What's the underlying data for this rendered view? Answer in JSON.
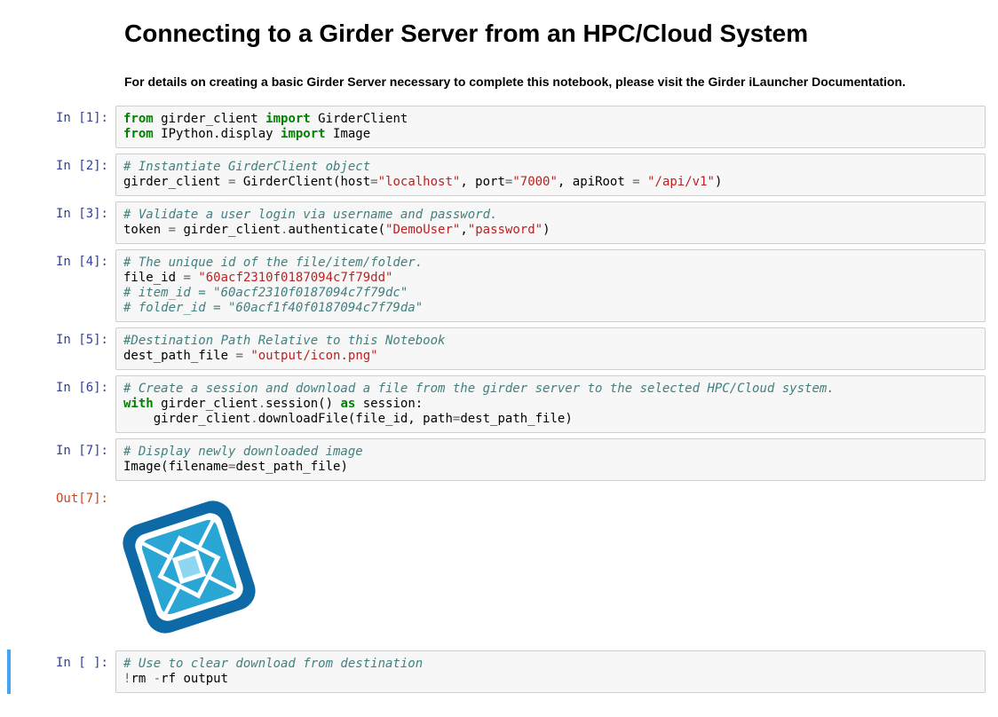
{
  "title": "Connecting to a Girder Server from an HPC/Cloud System",
  "subtitle": "For details on creating a basic Girder Server necessary to complete this notebook, please visit the Girder iLauncher Documentation.",
  "prompts": {
    "in1": "In [1]:",
    "in2": "In [2]:",
    "in3": "In [3]:",
    "in4": "In [4]:",
    "in5": "In [5]:",
    "in6": "In [6]:",
    "in7": "In [7]:",
    "out7": "Out[7]:",
    "inBlank": "In [ ]:"
  },
  "code1": {
    "kw_from1": "from",
    "mod1": " girder_client ",
    "kw_imp1": "import",
    "cls1": " GirderClient",
    "kw_from2": "from",
    "mod2": " IPython.display ",
    "kw_imp2": "import",
    "cls2": " Image"
  },
  "code2": {
    "cmt": "# Instantiate GirderClient object",
    "l2a": "girder_client ",
    "l2eq": "=",
    "l2b": " GirderClient(host",
    "l2eq2": "=",
    "s_host": "\"localhost\"",
    "l2c": ", port",
    "l2eq3": "=",
    "s_port": "\"7000\"",
    "l2d": ", apiRoot ",
    "l2eq4": "=",
    "s_api": " \"/api/v1\"",
    "l2e": ")"
  },
  "code3": {
    "cmt": "# Validate a user login via username and password.",
    "l1": "token ",
    "eq": "=",
    "l2": " girder_client",
    "dot": ".",
    "fn": "authenticate(",
    "s_user": "\"DemoUser\"",
    "comma": ",",
    "s_pass": "\"password\"",
    "close": ")"
  },
  "code4": {
    "cmt1": "# The unique id of the file/item/folder.",
    "l1": "file_id ",
    "eq": "=",
    "sp": " ",
    "s_id": "\"60acf2310f0187094c7f79dd\"",
    "cmt2": "# item_id = \"60acf2310f0187094c7f79dc\"",
    "cmt3": "# folder_id = \"60acf1f40f0187094c7f79da\""
  },
  "code5": {
    "cmt": "#Destination Path Relative to this Notebook",
    "l1": "dest_path_file ",
    "eq": "=",
    "sp": " ",
    "s_path": "\"output/icon.png\""
  },
  "code6": {
    "cmt": "# Create a session and download a file from the girder server to the selected HPC/Cloud system.",
    "kw_with": "with",
    "l1": " girder_client",
    "dot": ".",
    "fn1": "session() ",
    "kw_as": "as",
    "l2": " session:",
    "indent": "    girder_client",
    "dot2": ".",
    "fn2": "downloadFile(file_id, path",
    "eq": "=",
    "l3": "dest_path_file)"
  },
  "code7": {
    "cmt": "# Display newly downloaded image",
    "l1": "Image(filename",
    "eq": "=",
    "l2": "dest_path_file)"
  },
  "code8": {
    "cmt": "# Use to clear download from destination",
    "bang": "!",
    "l1": "rm ",
    "flag": "-",
    "l2": "rf output"
  }
}
